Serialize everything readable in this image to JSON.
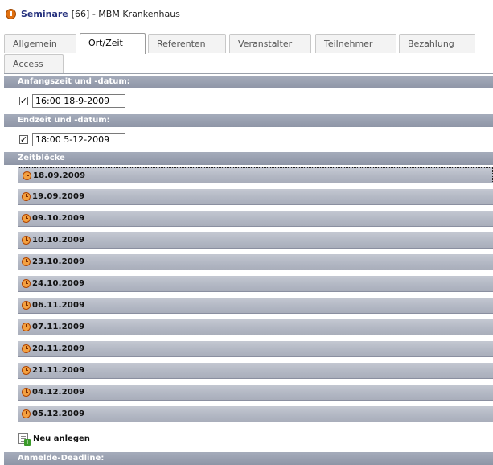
{
  "header": {
    "title_bold": "Seminare",
    "title_rest": "[66] - MBM Krankenhaus"
  },
  "tabs": [
    {
      "label": "Allgemein",
      "active": false
    },
    {
      "label": "Ort/Zeit",
      "active": true
    },
    {
      "label": "Referenten",
      "active": false
    },
    {
      "label": "Veranstalter",
      "active": false
    },
    {
      "label": "Teilnehmer",
      "active": false
    },
    {
      "label": "Bezahlung",
      "active": false
    },
    {
      "label": "Access",
      "active": false
    }
  ],
  "start": {
    "heading": "Anfangszeit und -datum:",
    "checked": true,
    "value": "16:00 18-9-2009"
  },
  "end": {
    "heading": "Endzeit und -datum:",
    "checked": true,
    "value": "18:00 5-12-2009"
  },
  "blocks": {
    "heading": "Zeitblöcke",
    "items": [
      "18.09.2009",
      "19.09.2009",
      "09.10.2009",
      "10.10.2009",
      "23.10.2009",
      "24.10.2009",
      "06.11.2009",
      "07.11.2009",
      "20.11.2009",
      "21.11.2009",
      "04.12.2009",
      "05.12.2009"
    ],
    "new_label": "Neu anlegen"
  },
  "deadline": {
    "heading": "Anmelde-Deadline:"
  },
  "colors": {
    "section_bar": "#9aa1b1",
    "title_blue": "#26327e",
    "icon_orange": "#e07010"
  }
}
